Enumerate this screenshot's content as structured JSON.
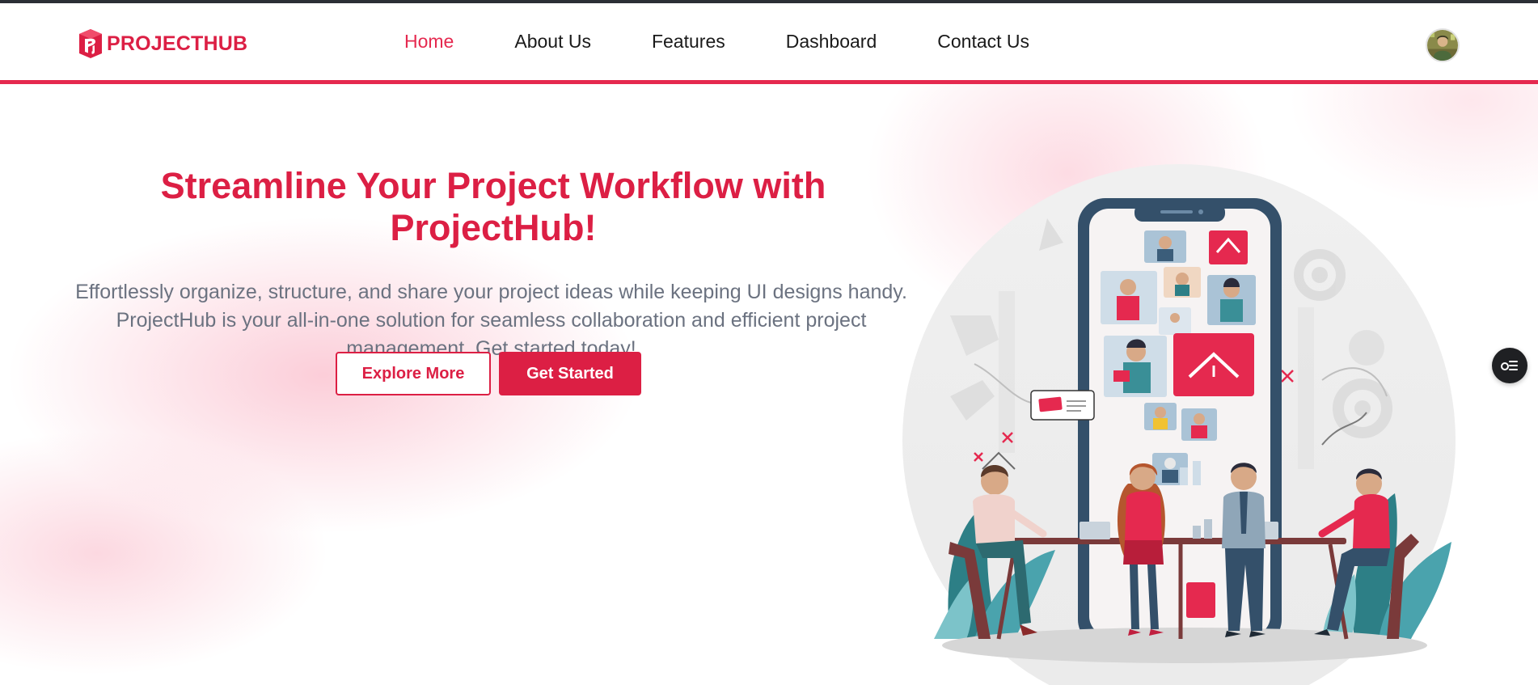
{
  "brand": {
    "name": "PROJECTHUB",
    "logo_icon": "projecthub-logo-icon",
    "color": "#dc1f44"
  },
  "nav": {
    "items": [
      {
        "label": "Home",
        "active": true
      },
      {
        "label": "About Us",
        "active": false
      },
      {
        "label": "Features",
        "active": false
      },
      {
        "label": "Dashboard",
        "active": false
      },
      {
        "label": "Contact Us",
        "active": false
      }
    ],
    "active_color": "#e5294f"
  },
  "user": {
    "avatar_icon": "user-avatar"
  },
  "hero": {
    "title": "Streamline Your Project Workflow with ProjectHub!",
    "description": "Effortlessly organize, structure, and share your project ideas while keeping UI designs handy. ProjectHub is your all-in-one solution for seamless collaboration and efficient project management. Get started today!",
    "primary_button": "Get Started",
    "secondary_button": "Explore More",
    "illustration_icon": "team-collaboration-illustration"
  },
  "widget": {
    "icon": "accessibility-menu-icon"
  },
  "colors": {
    "accent": "#dc1f44",
    "divider": "#e5294f",
    "text_muted": "#6b7280",
    "teal": "#3a8f97"
  }
}
